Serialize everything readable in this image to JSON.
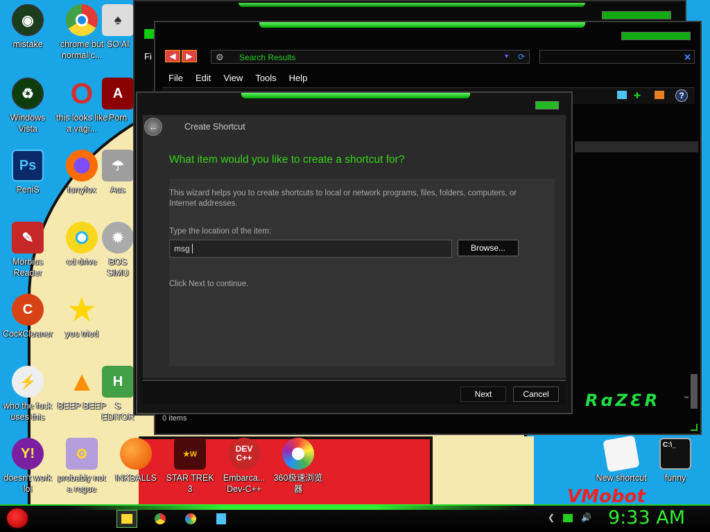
{
  "desktop": {
    "icons": [
      {
        "label": "mistake",
        "color": "#1b3d1b"
      },
      {
        "label": "chrome but normal c...",
        "color": "#e53935"
      },
      {
        "label": "SO AI",
        "color": "#dddddd"
      },
      {
        "label": "Windows Vista",
        "color": "#0d3d0d"
      },
      {
        "label": "this looks like a vagi...",
        "color": "#d32f2f"
      },
      {
        "label": "Porn",
        "color": "#8b0000"
      },
      {
        "label": "PeniS",
        "color": "#0a2a6a"
      },
      {
        "label": "furryfox",
        "color": "#ff6d00"
      },
      {
        "label": "Aus",
        "color": "#9e9e9e"
      },
      {
        "label": "Morbius Reader",
        "color": "#c62828"
      },
      {
        "label": "cd drive",
        "color": "#c0a000"
      },
      {
        "label": "BOS SIMU",
        "color": "#aaaaaa"
      },
      {
        "label": "CockCleaner",
        "color": "#d84315"
      },
      {
        "label": "you tried",
        "color": "#ffd600"
      },
      {
        "label": "who the fuck uses this",
        "color": "#eeeeee"
      },
      {
        "label": "BEEP BEEP",
        "color": "#ff8f00"
      },
      {
        "label": "S EDITOR",
        "color": "#43a047"
      },
      {
        "label": "doesn't work lol",
        "color": "#7b1fa2"
      },
      {
        "label": "probably not a rogue",
        "color": "#7e57c2"
      },
      {
        "label": "INKBALLS",
        "color": "#ef6c00"
      },
      {
        "label": "STAR TREK 3",
        "color": "#c62828"
      },
      {
        "label": "Embarca... Dev-C++",
        "color": "#c62828"
      },
      {
        "label": "360极速浏览器",
        "color": "#1e88e5"
      },
      {
        "label": "New shortcut",
        "color": "#f5f5f5"
      },
      {
        "label": "funny",
        "color": "#111111"
      }
    ],
    "wallpaper_text": "VMobot"
  },
  "explorer": {
    "back_label": "◀",
    "forward_label": "▶",
    "address": "Search Results",
    "search_clear": "✕",
    "menu": [
      "File",
      "Edit",
      "View",
      "Tools",
      "Help"
    ],
    "help": "?",
    "status": "0 items",
    "brand": "RɑZƐR",
    "brand_tm": "™",
    "behind_menu_fragment": "Fi"
  },
  "dialog": {
    "title": "Create Shortcut",
    "back_glyph": "←",
    "heading": "What item would you like to create a shortcut for?",
    "description": "This wizard helps you to create shortcuts to local or network programs, files, folders, computers, or Internet addresses.",
    "location_label": "Type the location of the item:",
    "location_value": "msg",
    "browse_label": "Browse...",
    "continue_text": "Click Next to continue.",
    "next_label": "Next",
    "cancel_label": "Cancel"
  },
  "taskbar": {
    "clock": "9:33 AM",
    "accent": "#33ee33"
  }
}
